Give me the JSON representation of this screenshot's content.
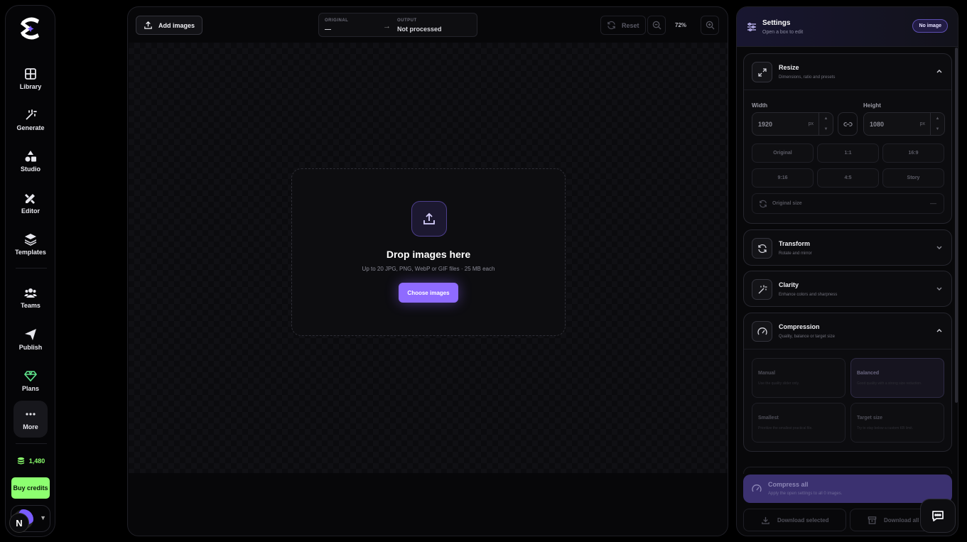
{
  "rail": {
    "items": [
      {
        "label": "Library",
        "icon": "grid-icon"
      },
      {
        "label": "Generate",
        "icon": "magic-wand-icon"
      },
      {
        "label": "Studio",
        "icon": "shapes-icon"
      },
      {
        "label": "Editor",
        "icon": "pencil-ruler-icon"
      },
      {
        "label": "Templates",
        "icon": "layers-icon"
      },
      {
        "label": "Teams",
        "icon": "users-icon"
      },
      {
        "label": "Publish",
        "icon": "send-icon"
      },
      {
        "label": "Plans",
        "icon": "gem-icon"
      },
      {
        "label": "More",
        "icon": "dots-icon"
      }
    ],
    "credits": "1,480",
    "buy_label": "Buy credits",
    "avatar_letter": "N",
    "accent_green": "#8dff70"
  },
  "toolbar": {
    "add_label": "Add images",
    "original_key": "ORIGINAL",
    "original_value": "—",
    "output_key": "OUTPUT",
    "output_value": "Not processed",
    "reset_label": "Reset",
    "zoom": "72%"
  },
  "dropzone": {
    "title": "Drop images here",
    "subtitle": "Up to 20 JPG, PNG, WebP or GIF files · 25 MB each",
    "button": "Choose images",
    "accent": "#8f6bff"
  },
  "settings": {
    "title": "Settings",
    "subtitle": "Open a box to edit",
    "badge": "No image",
    "resize": {
      "title": "Resize",
      "subtitle": "Dimensions, ratio and presets",
      "width_label": "Width",
      "width_value": "1920",
      "height_label": "Height",
      "height_value": "1080",
      "unit": "px",
      "presets": [
        "Original",
        "1:1",
        "16:9",
        "9:16",
        "4:5",
        "Story"
      ],
      "original_size_label": "Original size",
      "original_size_value": "—"
    },
    "transform": {
      "title": "Transform",
      "subtitle": "Rotate and mirror"
    },
    "clarity": {
      "title": "Clarity",
      "subtitle": "Enhance colors and sharpness"
    },
    "compression": {
      "title": "Compression",
      "subtitle": "Quality, balance or target size",
      "modes": [
        {
          "title": "Manual",
          "desc": "Use the quality slider only."
        },
        {
          "title": "Balanced",
          "desc": "Good quality with a strong size reduction."
        },
        {
          "title": "Smallest",
          "desc": "Prioritize the smallest practical file."
        },
        {
          "title": "Target size",
          "desc": "Try to stay below a custom KB limit."
        }
      ]
    },
    "compress_all": {
      "title": "Compress all",
      "desc": "Apply the open settings to all 0 images."
    },
    "download_selected": "Download selected",
    "download_all": "Download all"
  }
}
